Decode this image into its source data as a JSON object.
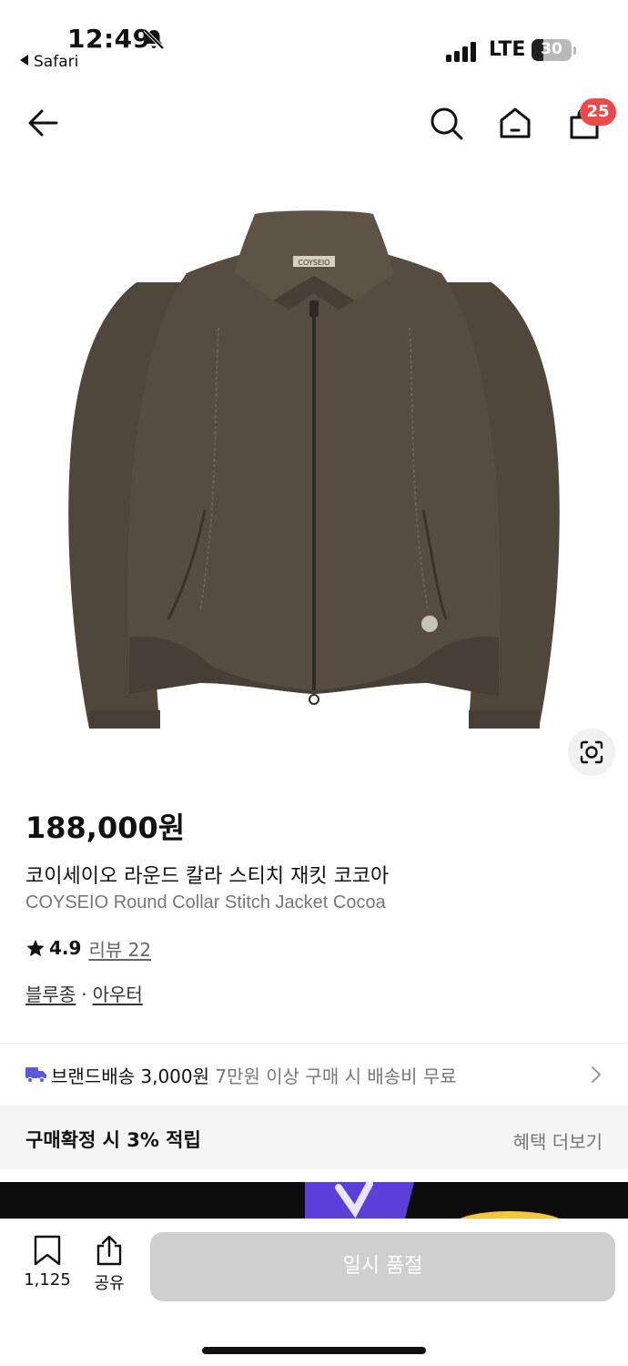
{
  "status_bar": {
    "time": "12:49",
    "back_app": "Safari",
    "network": "LTE",
    "battery": "30",
    "battery_level": 0.3
  },
  "nav": {
    "back_icon": "arrow-left-icon",
    "search_icon": "search-icon",
    "home_icon": "home-icon",
    "cart_icon": "shopping-bag-icon",
    "cart_count": "25"
  },
  "product": {
    "image_icon": "jacket-image",
    "brand_tag": "COYSEIO",
    "price": "188,000원",
    "name_ko": "코이세이오 라운드 칼라 스티치 재킷 코코아",
    "name_en": "COYSEIO Round Collar Stitch Jacket Cocoa",
    "rating": "4.9",
    "review_label": "리뷰 22",
    "category": [
      "블루종",
      "아우터"
    ],
    "category_separator": "·"
  },
  "shipping": {
    "label": "브랜드배송 3,000원",
    "note": "7만원 이상 구매 시 배송비 무료"
  },
  "benefit": {
    "text": "구매확정 시 3% 적립",
    "more": "혜택 더보기"
  },
  "bottom_bar": {
    "bookmark_count": "1,125",
    "share_label": "공유",
    "buy_label": "일시 품절"
  },
  "colors": {
    "badge": "#ef4a4a",
    "truck": "#5b5bd6",
    "disabled_button": "#cfcfcf",
    "jacket": "#4f463c"
  }
}
